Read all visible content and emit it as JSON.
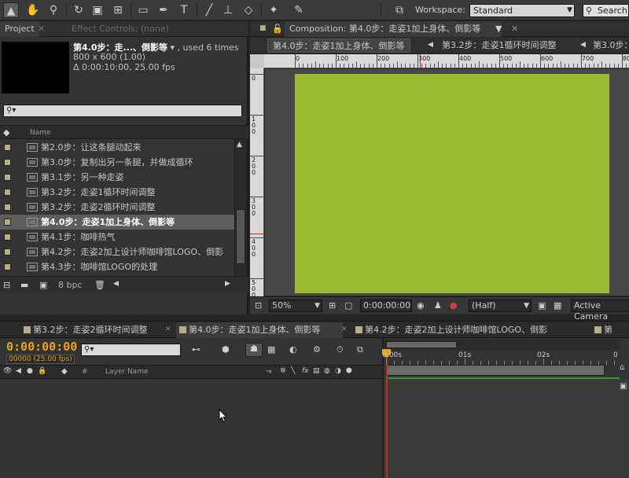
{
  "toolbar": {
    "tools": [
      "selection-tool",
      "hand-tool",
      "zoom-tool",
      "rotation-tool",
      "camera-tool",
      "pan-behind-tool",
      "shape-tool",
      "pen-tool",
      "type-tool",
      "brush-tool",
      "clone-stamp-tool",
      "eraser-tool",
      "roto-brush-tool",
      "puppet-pin-tool"
    ],
    "type_tool_glyph": "T",
    "workspace_label": "Workspace:",
    "workspace_value": "Standard",
    "search_label": "Search"
  },
  "project": {
    "tab_label": "Project",
    "effect_controls_label": "Effect Controls: (none)",
    "selected_name": "第4.0步：走...、倒影等",
    "used_times": ", used 6 times",
    "size_info": "800 x 600 (1.00)",
    "duration_info": "Δ 0:00:10:00, 25.00 fps",
    "search_placeholder": "",
    "column_name": "Name",
    "items": [
      {
        "label": "第2.0步：让这条腿动起来",
        "selected": false
      },
      {
        "label": "第3.0步：复制出另一条腿，并做成循环",
        "selected": false
      },
      {
        "label": "第3.1步：另一种走姿",
        "selected": false
      },
      {
        "label": "第3.2步：走姿1循环时间调整",
        "selected": false
      },
      {
        "label": "第3.2步：走姿2循环时间调整",
        "selected": false
      },
      {
        "label": "第4.0步：走姿1加上身体、倒影等",
        "selected": true
      },
      {
        "label": "第4.1步：咖啡热气",
        "selected": false
      },
      {
        "label": "第4.2步：走姿2加上设计师咖啡馆LOGO、倒影",
        "selected": false
      },
      {
        "label": "第4.3步：咖啡馆LOGO的处理",
        "selected": false
      }
    ],
    "bpc_label": "8 bpc"
  },
  "composition": {
    "tab_label": "Composition: 第4.0步：走姿1加上身体、倒影等",
    "subtabs": [
      "第4.0步：走姿1加上身体、倒影等",
      "第3.2步：走姿1循环时间调整",
      "第3.0步："
    ],
    "ruler_ticks": [
      "0",
      "100",
      "200",
      "300",
      "400",
      "500",
      "600",
      "700",
      "800"
    ],
    "ruler_v_ticks": [
      "0",
      "1\n0\n0",
      "2\n0\n0",
      "3\n0\n0",
      "4\n0\n0",
      "5\n0\n0"
    ],
    "canvas_color": "#98bb31",
    "zoom": "50%",
    "timecode": "0:00:00:00",
    "resolution": "(Half)",
    "camera": "Active Camera"
  },
  "timeline": {
    "tabs": [
      {
        "label": "第3.2步：走姿2循环时间调整",
        "active": false
      },
      {
        "label": "第4.0步：走姿1加上身体、倒影等",
        "active": true
      },
      {
        "label": "第4.2步：走姿2加上设计师咖啡馆LOGO、倒影",
        "active": false
      },
      {
        "label": "第",
        "active": false
      }
    ],
    "timecode": "0:00:00:00",
    "timecode_sub": "00000 (25.00 fps)",
    "search_placeholder": "",
    "hash_label": "#",
    "layer_name_label": "Layer Name",
    "fx_label": "fx",
    "time_labels": [
      "0:00s",
      "01s",
      "02s",
      "0"
    ]
  }
}
